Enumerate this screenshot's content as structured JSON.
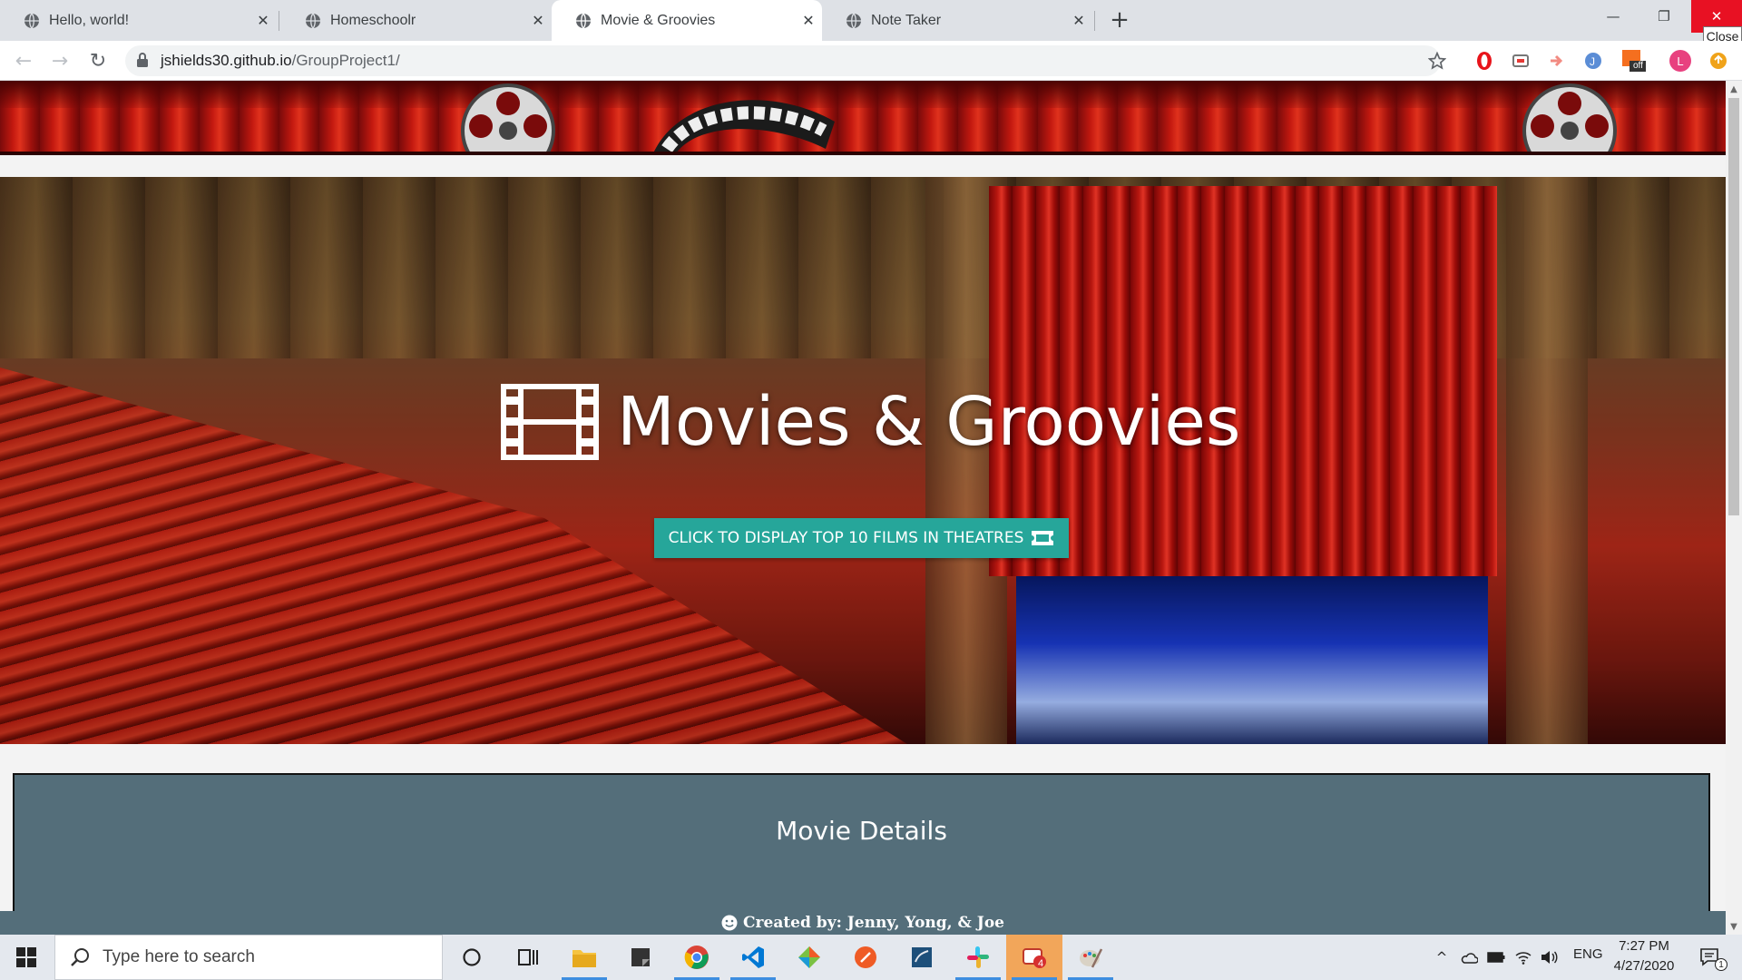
{
  "browser": {
    "tabs": [
      {
        "label": "Hello, world!"
      },
      {
        "label": "Homeschoolr"
      },
      {
        "label": "Movie & Groovies"
      },
      {
        "label": "Note Taker"
      }
    ],
    "active_tab_index": 2,
    "url_host": "jshields30.github.io",
    "url_path": "/GroupProject1/",
    "close_tooltip": "Close",
    "profile_initial": "L",
    "extension_badge": "off"
  },
  "page": {
    "title": "Movies & Groovies",
    "cta_label": "CLICK TO DISPLAY TOP 10 FILMS IN THEATRES",
    "details_title": "Movie Details",
    "footer": "Created by: Jenny, Yong, & Joe"
  },
  "taskbar": {
    "search_placeholder": "Type here to search",
    "language": "ENG",
    "time": "7:27 PM",
    "date": "4/27/2020",
    "notification_count": "1",
    "mail_badge": "4"
  },
  "colors": {
    "accent": "#26a69a",
    "details_bg": "#546e7a",
    "close_red": "#e81123"
  }
}
